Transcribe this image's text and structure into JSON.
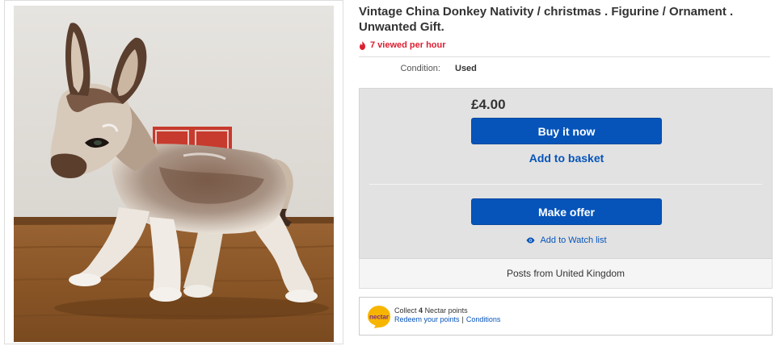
{
  "listing": {
    "title": "Vintage China Donkey Nativity / christmas . Figurine / Ornament . Unwanted Gift.",
    "image_alt": "china-donkey-figurine-photo",
    "viewed": "7 viewed per hour",
    "condition_label": "Condition:",
    "condition_value": "Used"
  },
  "buybox": {
    "price": "£4.00",
    "buy_now": "Buy it now",
    "add_to_basket": "Add to basket",
    "make_offer": "Make offer",
    "watch_list": "Add to Watch list",
    "shipping": "Posts from United Kingdom"
  },
  "nectar": {
    "logo_text": "nectar",
    "collect_prefix": "Collect",
    "points": "4",
    "collect_suffix": "Nectar points",
    "redeem": "Redeem your points",
    "separator": "|",
    "conditions": "Conditions"
  },
  "colors": {
    "primary_button": "#0654ba",
    "link": "#0654ba",
    "urgency": "#dd1e31",
    "buybox_bg": "#e2e2e2",
    "nectar_yellow": "#f7b500"
  },
  "icons": {
    "viewed": "flame-icon",
    "watch": "eye-icon",
    "nectar": "nectar-logo"
  }
}
